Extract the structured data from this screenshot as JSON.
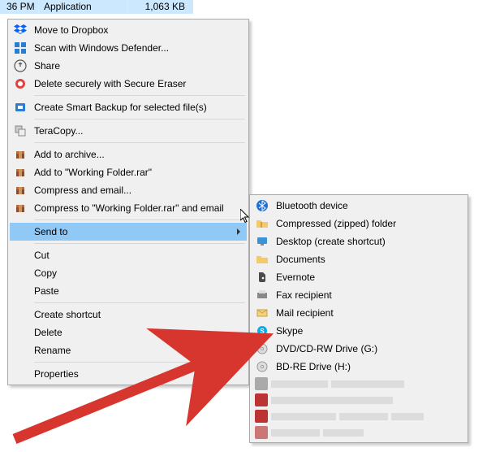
{
  "file_row": {
    "time": "36 PM",
    "type": "Application",
    "size": "1,063 KB"
  },
  "context_menu": {
    "move_dropbox": "Move to Dropbox",
    "scan_defender": "Scan with Windows Defender...",
    "share": "Share",
    "delete_secure": "Delete securely with Secure Eraser",
    "smart_backup": "Create Smart Backup for selected file(s)",
    "teracopy": "TeraCopy...",
    "add_archive": "Add to archive...",
    "add_working": "Add to \"Working Folder.rar\"",
    "compress_email": "Compress and email...",
    "compress_working_email": "Compress to \"Working Folder.rar\" and email",
    "send_to": "Send to",
    "cut": "Cut",
    "copy": "Copy",
    "paste": "Paste",
    "create_shortcut": "Create shortcut",
    "delete": "Delete",
    "rename": "Rename",
    "properties": "Properties"
  },
  "send_to_menu": {
    "bluetooth": "Bluetooth device",
    "compressed": "Compressed (zipped) folder",
    "desktop": "Desktop (create shortcut)",
    "documents": "Documents",
    "evernote": "Evernote",
    "fax": "Fax recipient",
    "mail": "Mail recipient",
    "skype": "Skype",
    "dvd": "DVD/CD-RW Drive (G:)",
    "bdre": "BD-RE Drive (H:)"
  },
  "colors": {
    "highlight": "#90c8f6",
    "menu_bg": "#f0f0f0",
    "row_sel": "#cce8ff",
    "arrow": "#d7362e"
  }
}
